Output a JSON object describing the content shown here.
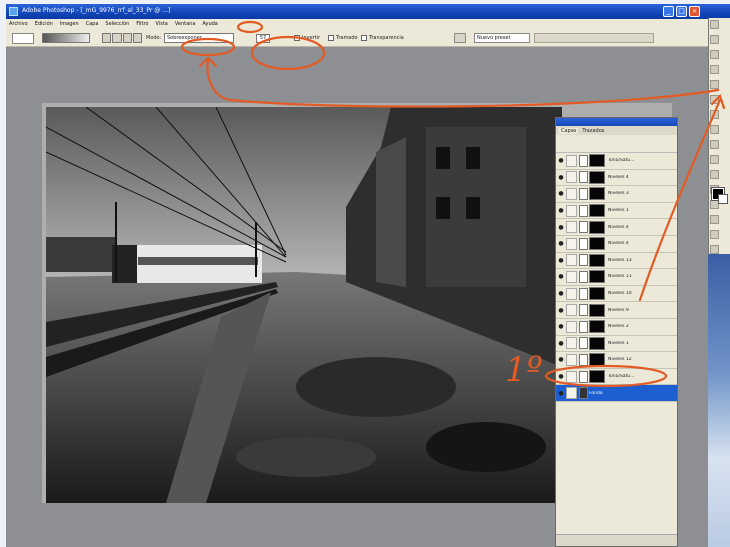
{
  "window": {
    "title": "Adobe Photoshop - [_mG_9976_rrf_al_33_Pr @ ...]",
    "controls": [
      "_",
      "□",
      "×"
    ]
  },
  "menu": [
    "Archivo",
    "Edición",
    "Imagen",
    "Capa",
    "Selección",
    "Filtro",
    "Vista",
    "Ventana",
    "Ayuda"
  ],
  "options_bar": {
    "mode_label": "Modo:",
    "mode_value": "Sobreexponer",
    "opacity_value": "57",
    "checkbox_1": "Invertir",
    "checkbox_2": "Tramado",
    "checkbox_3": "Transparencia",
    "search_placeholder": "Nuevo preset"
  },
  "layers_panel": {
    "tabs": [
      "Capas",
      "Trazados"
    ],
    "layers": [
      {
        "name": "Tono/Satu..."
      },
      {
        "name": "Niveles 4"
      },
      {
        "name": "Niveles 3"
      },
      {
        "name": "Niveles 1"
      },
      {
        "name": "Niveles 4"
      },
      {
        "name": "Niveles 4"
      },
      {
        "name": "Niveles 13"
      },
      {
        "name": "Niveles 11"
      },
      {
        "name": "Niveles 10"
      },
      {
        "name": "Niveles 9"
      },
      {
        "name": "Niveles 2"
      },
      {
        "name": "Niveles 1"
      },
      {
        "name": "Niveles 12"
      },
      {
        "name": "Tono/Satu..."
      },
      {
        "name": "Fondo",
        "selected": true
      }
    ]
  },
  "annotation": {
    "label": "1º",
    "color": "#e25b24"
  }
}
